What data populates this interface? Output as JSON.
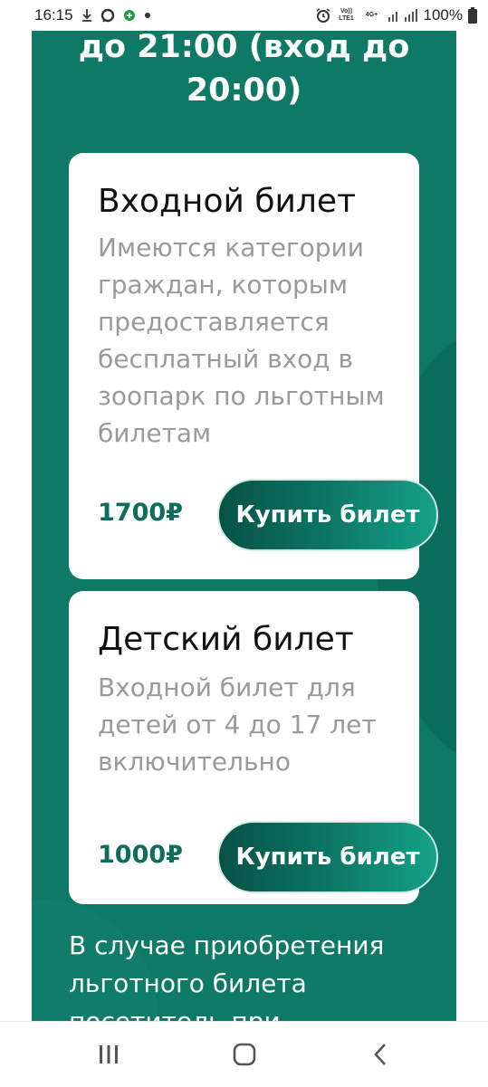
{
  "status_bar": {
    "time": "16:15",
    "net_volte": "Vo)) LTE1",
    "net_4g": "4G+",
    "battery": "100%",
    "icons": [
      "download-icon",
      "chat-icon",
      "app-icon",
      "dot-icon",
      "alarm-icon",
      "signal-icon",
      "battery-icon"
    ]
  },
  "header": {
    "hours_text": "до 21:00 (вход до\n20:00)"
  },
  "tickets": [
    {
      "title": "Входной билет",
      "description": "Имеются категории граждан, которым предоставляется бесплатный вход в зоопарк по льготным билетам",
      "price": "1700₽",
      "button": "Купить билет"
    },
    {
      "title": "Детский билет",
      "description": "Входной билет для детей от 4 до 17 лет включительно",
      "price": "1000₽",
      "button": "Купить билет"
    }
  ],
  "note": "В случае приобретения льготного билета посетитель при",
  "colors": {
    "panel": "#0e7a66",
    "price": "#0e6d5d",
    "button_start": "#075246",
    "button_end": "#14a287"
  },
  "nav": {
    "icons": [
      "recent-apps-icon",
      "home-icon",
      "back-icon"
    ]
  }
}
